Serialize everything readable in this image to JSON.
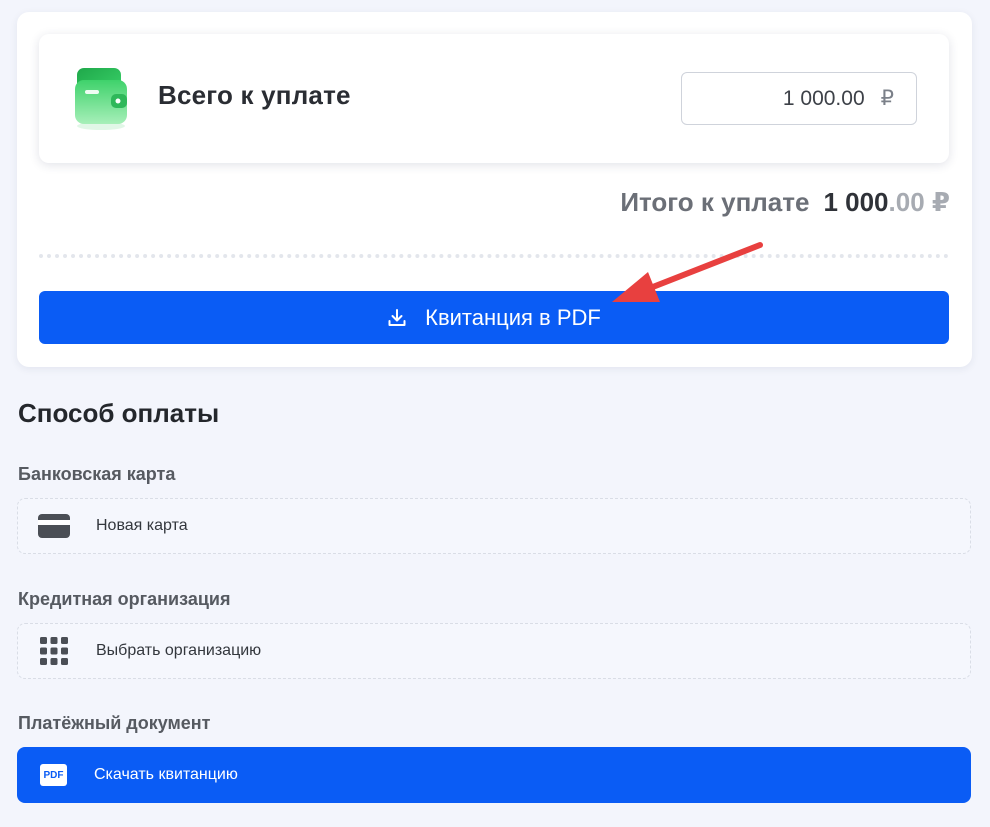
{
  "summary": {
    "total_label": "Всего к уплате",
    "amount_value": "1 000.00",
    "currency_symbol": "₽",
    "grand_total_label": "Итого к уплате",
    "grand_total_int": "1 000",
    "grand_total_dec": ".00 ₽",
    "pdf_button_label": "Квитанция в PDF"
  },
  "payment": {
    "section_title": "Способ оплаты",
    "bank_card_label": "Банковская карта",
    "new_card_label": "Новая карта",
    "credit_org_label": "Кредитная организация",
    "choose_org_label": "Выбрать организацию",
    "payment_doc_label": "Платёжный документ",
    "pdf_badge": "PDF",
    "download_label": "Скачать квитанцию"
  },
  "colors": {
    "accent": "#0a5cf5",
    "background": "#f3f5fc",
    "wallet_green": "#3ecf6a",
    "arrow_red": "#e8403f"
  },
  "icons": {
    "wallet": "wallet-icon",
    "download": "download-icon",
    "card": "credit-card-icon",
    "grid": "grid-icon",
    "pdf": "pdf-icon",
    "arrow": "annotation-arrow"
  }
}
